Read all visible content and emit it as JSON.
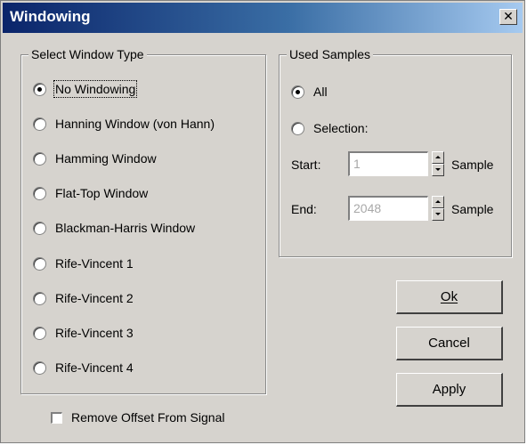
{
  "window": {
    "title": "Windowing",
    "close_label": "✕"
  },
  "window_type": {
    "legend": "Select Window Type",
    "selected": "No Windowing",
    "options": [
      "No Windowing",
      "Hanning Window (von Hann)",
      "Hamming Window",
      "Flat-Top Window",
      "Blackman-Harris Window",
      "Rife-Vincent 1",
      "Rife-Vincent 2",
      "Rife-Vincent 3",
      "Rife-Vincent 4"
    ]
  },
  "used_samples": {
    "legend": "Used Samples",
    "options": [
      "All",
      "Selection:"
    ],
    "selected": "All",
    "start_label": "Start:",
    "start_value": "1",
    "start_unit": "Sample",
    "end_label": "End:",
    "end_value": "2048",
    "end_unit": "Sample"
  },
  "buttons": {
    "ok": "Ok",
    "cancel": "Cancel",
    "apply": "Apply"
  },
  "remove_offset": {
    "label": "Remove Offset From Signal",
    "checked": false
  },
  "colors": {
    "dialog_bg": "#d6d3ce",
    "title_start": "#0a246a",
    "title_end": "#a6caf0",
    "disabled_text": "#a8a8a8"
  }
}
